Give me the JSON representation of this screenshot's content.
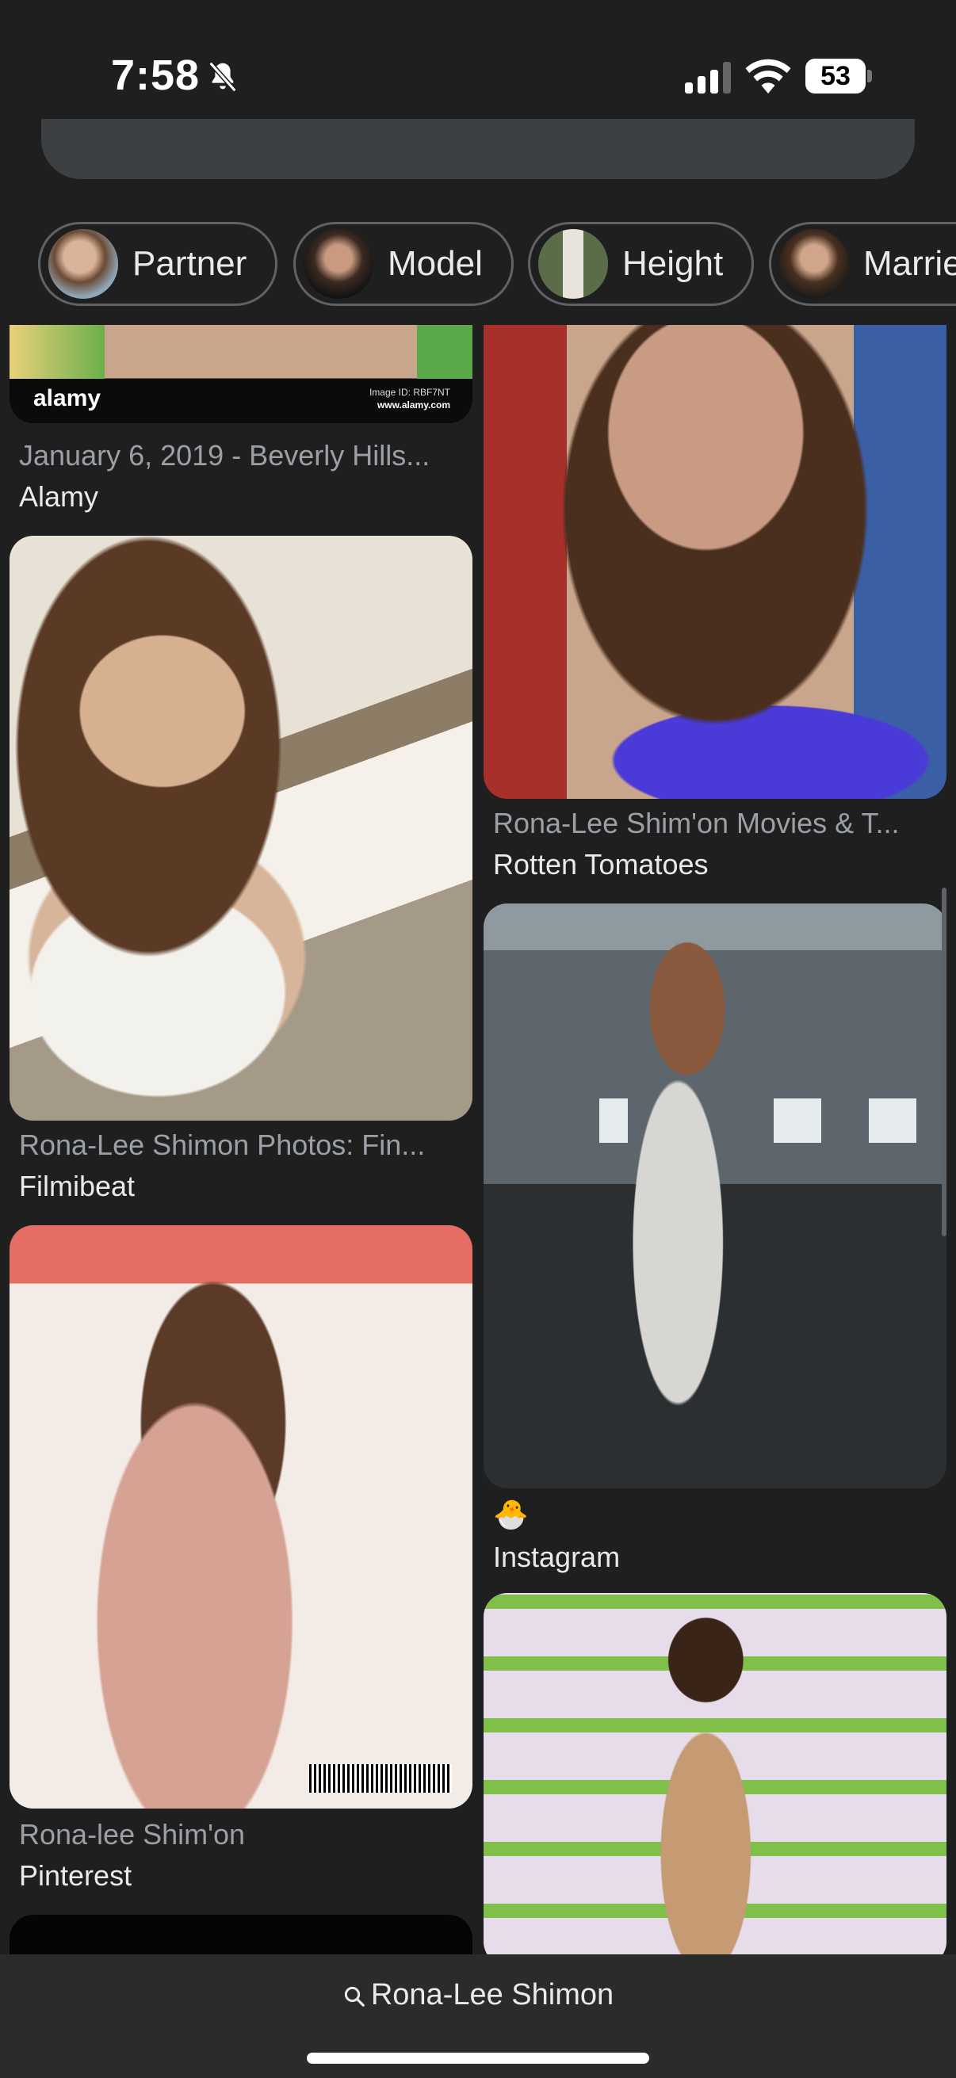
{
  "status": {
    "time": "7:58",
    "battery": "53"
  },
  "chips": [
    {
      "label": "Partner"
    },
    {
      "label": "Model"
    },
    {
      "label": "Height"
    },
    {
      "label": "Married"
    }
  ],
  "results": {
    "left": [
      {
        "title": "January 6, 2019 - Beverly Hills...",
        "source": "Alamy",
        "watermark": "alamy",
        "image_id": "Image ID: RBF7NT",
        "site": "www.alamy.com"
      },
      {
        "title": "Rona-Lee Shimon Photos: Fin...",
        "source": "Filmibeat"
      },
      {
        "title": "Rona-lee Shim'on",
        "source": "Pinterest"
      }
    ],
    "right": [
      {
        "title": "Rona-Lee Shim'on Movies & T...",
        "source": "Rotten Tomatoes"
      },
      {
        "title": "🐣",
        "source": "Instagram"
      },
      {
        "title": "",
        "source": ""
      }
    ]
  },
  "bottom": {
    "query": "Rona-Lee Shimon"
  },
  "icons": {
    "bell": "bell-slash-icon",
    "signal": "cellular-signal-icon",
    "wifi": "wifi-icon",
    "battery": "battery-icon",
    "search": "search-icon"
  },
  "colors": {
    "background": "#1f1f1f",
    "chip_border": "#5f6368",
    "title_gray": "#9aa0a6",
    "text_light": "#e8eaed"
  }
}
